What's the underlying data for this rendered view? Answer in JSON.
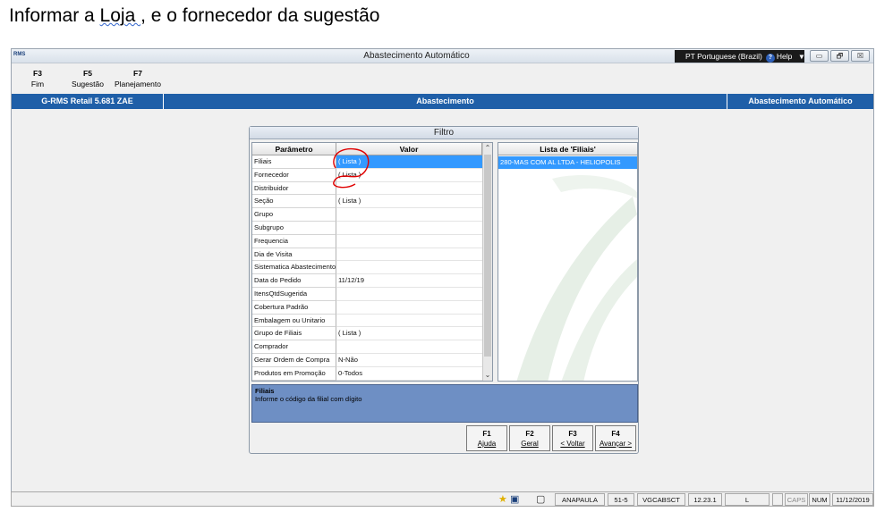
{
  "caption": {
    "pre": "Informar a ",
    "underlined": "Loja ",
    "post": ", e o fornecedor da sugestão"
  },
  "window": {
    "logo": "RMS",
    "title": "Abastecimento Automático",
    "language": "PT Portuguese (Brazil)",
    "help": "Help",
    "buttons": {
      "minimize": "▭",
      "restore": "🗗",
      "close": "☒"
    }
  },
  "fkeys": [
    {
      "key": "F3",
      "label": "Fim"
    },
    {
      "key": "F5",
      "label": "Sugestão"
    },
    {
      "key": "F7",
      "label": "Planejamento"
    }
  ],
  "bluebar": {
    "left": "G-RMS Retail 5.681 ZAE",
    "center": "Abastecimento",
    "right": "Abastecimento Automático"
  },
  "filtro": {
    "title": "Filtro",
    "col_param": "Parâmetro",
    "col_value": "Valor",
    "rows": [
      {
        "param": "Filiais",
        "value": "( Lista )"
      },
      {
        "param": "Fornecedor",
        "value": "( Lista )"
      },
      {
        "param": "Distribuidor",
        "value": ""
      },
      {
        "param": "Seção",
        "value": "( Lista )"
      },
      {
        "param": "Grupo",
        "value": ""
      },
      {
        "param": "Subgrupo",
        "value": ""
      },
      {
        "param": "Frequencia",
        "value": ""
      },
      {
        "param": "Dia de Visita",
        "value": ""
      },
      {
        "param": "Sistematica Abastecimento",
        "value": ""
      },
      {
        "param": "Data do Pedido",
        "value": "11/12/19"
      },
      {
        "param": "ItensQtdSugerida",
        "value": ""
      },
      {
        "param": "Cobertura Padrão",
        "value": ""
      },
      {
        "param": "Embalagem ou Unitario",
        "value": ""
      },
      {
        "param": "Grupo de Filiais",
        "value": "( Lista )"
      },
      {
        "param": "Comprador",
        "value": ""
      },
      {
        "param": "Gerar Ordem de Compra",
        "value": "N-Não"
      },
      {
        "param": "Produtos em Promoção",
        "value": "0-Todos"
      }
    ],
    "list_header": "Lista de 'Filiais'",
    "list_items": [
      "280-MAS COM AL LTDA - HELIOPOLIS"
    ],
    "help_title": "Filiais",
    "help_text": "Informe o código da filial com dígito",
    "buttons": [
      {
        "key": "F1",
        "label": "Ajuda"
      },
      {
        "key": "F2",
        "label": "Geral"
      },
      {
        "key": "F3",
        "label": "< Voltar"
      },
      {
        "key": "F4",
        "label": "Avançar >"
      }
    ]
  },
  "status": {
    "user": "ANAPAULA",
    "code": "51-5",
    "program": "VGCABSCT",
    "version": "12.23.1",
    "mode": "L",
    "caps": "CAPS",
    "num": "NUM",
    "date": "11/12/2019"
  },
  "colors": {
    "accent": "#1f5fa8",
    "selection": "#3399ff",
    "help_bg": "#6e8fc4",
    "annotation": "#e00000"
  }
}
